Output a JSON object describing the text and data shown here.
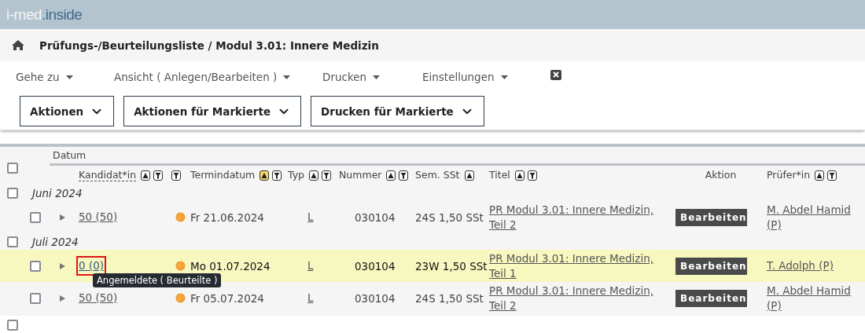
{
  "logo": {
    "part_1": "i-med",
    "part_2": ".inside"
  },
  "breadcrumb": "Prüfungs-/Beurteilungsliste / Modul 3.01: Innere Medizin",
  "menu": [
    {
      "label": "Gehe zu"
    },
    {
      "label": "Ansicht ( Anlegen/Bearbeiten )"
    },
    {
      "label": "Drucken"
    },
    {
      "label": "Einstellungen"
    }
  ],
  "action_buttons": [
    "Aktionen",
    "Aktionen für Markierte",
    "Drucken für Markierte"
  ],
  "table": {
    "header_checked": false,
    "group_heading": "Datum",
    "columns": [
      {
        "label": "Kandidat*in",
        "sort": true,
        "filter": true,
        "dotted": true
      },
      {
        "filter": true
      },
      {
        "label": "Termindatum",
        "sort": true,
        "sort_active": true,
        "filter": true
      },
      {
        "label": "Typ",
        "sort": true,
        "filter": true
      },
      {
        "label": "Nummer",
        "sort": true,
        "filter": true
      },
      {
        "label": "Sem. SSt",
        "sort": true
      },
      {
        "label": "Titel",
        "sort": true,
        "filter": true
      },
      {
        "label": "Aktion"
      },
      {
        "label": "Prüfer*in",
        "sort": true,
        "filter": true
      }
    ],
    "groups": [
      {
        "label": "Juni 2024",
        "checked": false,
        "rows": [
          {
            "checked": false,
            "selected": false,
            "candidates": "50 (50)",
            "date": "Fr 21.06.2024",
            "type": "L",
            "number": "030104",
            "semester": "24S 1,50 SSt",
            "title": "PR Modul 3.01: Innere Medizin, Teil 2",
            "action": "Bearbeiten",
            "examiner": "M. Abdel Hamid (P)"
          }
        ]
      },
      {
        "label": "Juli 2024",
        "checked": false,
        "rows": [
          {
            "checked": false,
            "selected": true,
            "candidates": "0 (0)",
            "date": "Mo 01.07.2024",
            "type": "L",
            "number": "030104",
            "semester": "23W 1,50 SSt",
            "title": "PR Modul 3.01: Innere Medizin, Teil 1",
            "action": "Bearbeiten",
            "examiner": "T. Adolph (P)",
            "tooltip": "Angemeldete ( Beurteilte )"
          },
          {
            "checked": false,
            "selected": false,
            "candidates": "50 (50)",
            "date": "Fr 05.07.2024",
            "type": "L",
            "number": "030104",
            "semester": "24S 1,50 SSt",
            "title": "PR Modul 3.01: Innere Medizin, Teil 2",
            "action": "Bearbeiten",
            "examiner": "M. Abdel Hamid (P)"
          }
        ]
      }
    ],
    "footer_checked": false
  }
}
